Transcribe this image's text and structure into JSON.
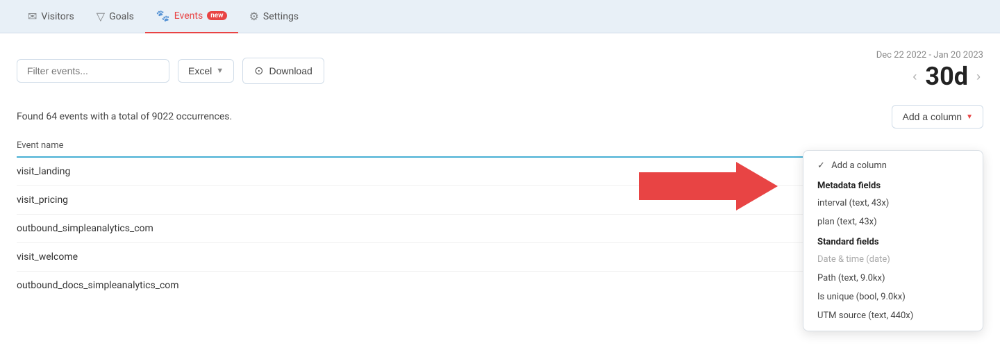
{
  "nav": {
    "items": [
      {
        "id": "visitors",
        "label": "Visitors",
        "icon": "✉",
        "active": false
      },
      {
        "id": "goals",
        "label": "Goals",
        "icon": "⊿",
        "active": false
      },
      {
        "id": "events",
        "label": "Events",
        "icon": "🐾",
        "active": true,
        "badge": "new"
      },
      {
        "id": "settings",
        "label": "Settings",
        "icon": "⚙",
        "active": false
      }
    ]
  },
  "toolbar": {
    "filter_placeholder": "Filter events...",
    "excel_label": "Excel",
    "download_label": "Download",
    "download_icon": "⊙"
  },
  "date_range": {
    "range_text": "Dec 22 2022 - Jan 20 2023",
    "period_label": "30d",
    "prev_label": "‹",
    "next_label": "›"
  },
  "summary": {
    "text": "Found 64 events with a total of 9022 occurrences.",
    "add_column_label": "Add a column"
  },
  "table": {
    "column_header": "Event name"
  },
  "events": [
    {
      "name": "visit_landing"
    },
    {
      "name": "visit_pricing"
    },
    {
      "name": "outbound_simpleanalytics_com"
    },
    {
      "name": "visit_welcome"
    },
    {
      "name": "outbound_docs_simpleanalytics_com"
    }
  ],
  "dropdown": {
    "checked_item": "Add a column",
    "sections": [
      {
        "type": "header",
        "label": "Metadata fields"
      },
      {
        "type": "item",
        "label": "interval (text, 43x)"
      },
      {
        "type": "item",
        "label": "plan (text, 43x)"
      },
      {
        "type": "header",
        "label": "Standard fields"
      },
      {
        "type": "item",
        "label": "Date & time (date)",
        "disabled": true
      },
      {
        "type": "item",
        "label": "Path (text, 9.0kx)"
      },
      {
        "type": "item",
        "label": "Is unique (bool, 9.0kx)"
      },
      {
        "type": "item",
        "label": "UTM source (text, 440x)"
      }
    ]
  },
  "colors": {
    "active_nav": "#e84444",
    "accent_blue": "#48b0d4",
    "badge_bg": "#e84444"
  }
}
